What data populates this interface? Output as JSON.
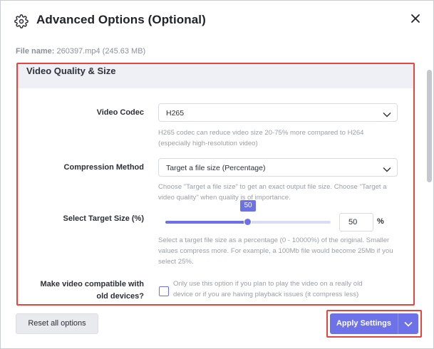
{
  "dialog": {
    "title": "Advanced Options (Optional)",
    "gear_icon": "gear-icon",
    "close_icon": "close-icon"
  },
  "file": {
    "label": "File name:",
    "value": "260397.mp4 (245.63 MB)"
  },
  "section": {
    "title": "Video Quality & Size"
  },
  "video_codec": {
    "label": "Video Codec",
    "value": "H265",
    "help_line1": "H265 codec can reduce video size 20-75% more compared to H264",
    "help_line2": "(especially high-resolution video)"
  },
  "compression": {
    "label": "Compression Method",
    "value": "Target a file size (Percentage)",
    "help_line1": "Choose \"Target a file size\" to get an exact output file size. Choose \"Target a",
    "help_line2": "video quality\" when quality is of importance."
  },
  "target_size": {
    "label": "Select Target Size (%)",
    "slider_value": 50,
    "slider_min": 0,
    "slider_max": 100,
    "bubble": "50",
    "input_value": "50",
    "unit": "%",
    "help_line1": "Select a target file size as a percentage (0 - 10000%) of the original. Smaller",
    "help_line2": "values compress more. For example, a 100Mb file would become 25Mb if you",
    "help_line3": "select 25%."
  },
  "compat": {
    "label_line1": "Make video compatible with",
    "label_line2": "old devices?",
    "checked": false,
    "help_line1": "Only use this option if you plan to play the video on a really old",
    "help_line2": "device or if you are having playback issues (it compress less)"
  },
  "footer": {
    "reset_label": "Reset all options",
    "apply_label": "Apply Settings",
    "dropdown_icon": "chevron-down-icon"
  },
  "colors": {
    "accent": "#6e72e8",
    "highlight_border": "#e5453c",
    "section_header_bg": "#eef0f6"
  }
}
